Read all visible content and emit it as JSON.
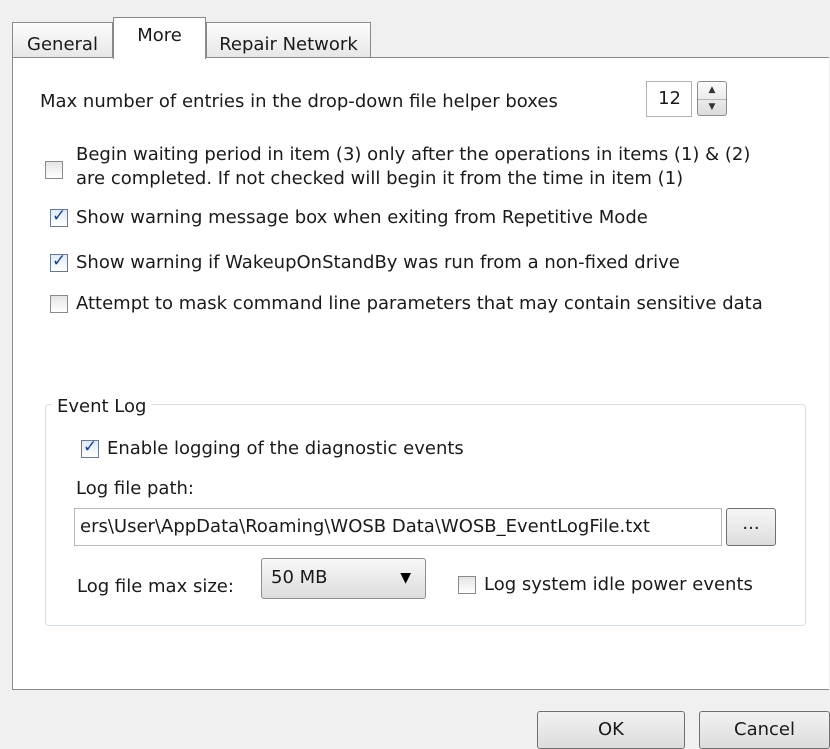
{
  "tabs": [
    {
      "label": "General"
    },
    {
      "label": "More"
    },
    {
      "label": "Repair Network"
    }
  ],
  "max_entries": {
    "label": "Max number of entries in the drop-down file helper boxes",
    "value": "12"
  },
  "options": [
    {
      "line1": "Begin waiting period in item (3) only after the operations in items (1) & (2)",
      "line2": "are completed. If not checked will begin it from the time in item (1)",
      "checked": false
    },
    {
      "label": "Show warning message box when exiting from Repetitive Mode",
      "checked": true
    },
    {
      "label": "Show warning if WakeupOnStandBy was run from a non-fixed drive",
      "checked": true
    },
    {
      "label": "Attempt to mask command line parameters that may contain sensitive data",
      "checked": false
    }
  ],
  "event_log": {
    "title": "Event Log",
    "enable_label": "Enable logging of the diagnostic events",
    "enable_checked": true,
    "path_label": "Log file path:",
    "path_value": "ers\\User\\AppData\\Roaming\\WOSB Data\\WOSB_EventLogFile.txt",
    "browse_label": "...",
    "max_size_label": "Log file max size:",
    "max_size_value": "50 MB",
    "idle_label": "Log system idle power events",
    "idle_checked": false
  },
  "buttons": {
    "ok": "OK",
    "cancel": "Cancel"
  }
}
